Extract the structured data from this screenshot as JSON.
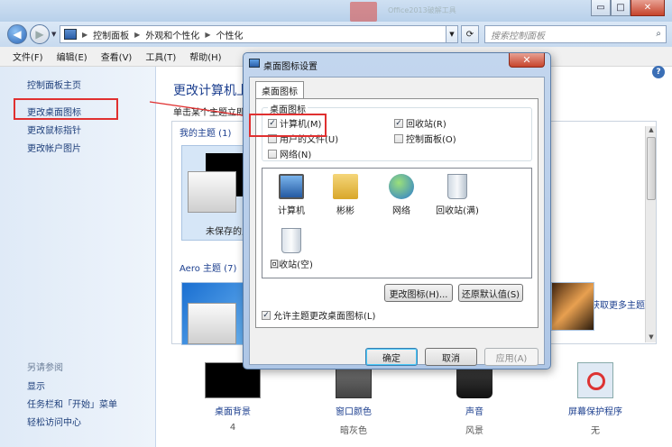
{
  "window": {
    "bg_app_text": "Office2013破解工具",
    "min_btn": "▭",
    "max_btn": "□",
    "close_btn": "✕"
  },
  "nav": {
    "back": "◀",
    "forward": "▶",
    "breadcrumb": [
      "控制面板",
      "外观和个性化",
      "个性化"
    ],
    "refresh": "⟳",
    "search_placeholder": "搜索控制面板",
    "search_icon": "⌕"
  },
  "menu": [
    "文件(F)",
    "编辑(E)",
    "查看(V)",
    "工具(T)",
    "帮助(H)"
  ],
  "help": "?",
  "sidebar": {
    "home": "控制面板主页",
    "links": [
      "更改桌面图标",
      "更改鼠标指针",
      "更改帐户图片"
    ],
    "see_also_title": "另请参阅",
    "see_also": [
      "显示",
      "任务栏和「开始」菜单",
      "轻松访问中心"
    ]
  },
  "main": {
    "title": "更改计算机上",
    "subtitle": "单击某个主题立即",
    "my_themes": "我的主题 (1)",
    "unsaved": "未保存的主",
    "aero": "Aero 主题 (7)",
    "more_themes": "联机获取更多主题",
    "bottom": [
      {
        "label": "桌面背景",
        "value": "4"
      },
      {
        "label": "窗口颜色",
        "value": "暗灰色"
      },
      {
        "label": "声音",
        "value": "风景"
      },
      {
        "label": "屏幕保护程序",
        "value": "无"
      }
    ]
  },
  "dialog": {
    "title": "桌面图标设置",
    "close": "✕",
    "tab": "桌面图标",
    "group_title": "桌面图标",
    "checkboxes": [
      {
        "label": "计算机(M)",
        "checked": "✓"
      },
      {
        "label": "回收站(R)",
        "checked": "✓"
      },
      {
        "label": "用户的文件(U)",
        "checked": ""
      },
      {
        "label": "控制面板(O)",
        "checked": ""
      },
      {
        "label": "网络(N)",
        "checked": ""
      }
    ],
    "icons": [
      "计算机",
      "彬彬",
      "网络",
      "回收站(满)",
      "回收站(空)"
    ],
    "change_icon": "更改图标(H)...",
    "restore_default": "还原默认值(S)",
    "allow_themes": "允许主题更改桌面图标(L)",
    "allow_checked": "✓",
    "ok": "确定",
    "cancel": "取消",
    "apply": "应用(A)"
  },
  "colors": {
    "link": "#1c3f8f",
    "highlight_box": "#e03030",
    "title_bar": "#cfe0f2"
  }
}
